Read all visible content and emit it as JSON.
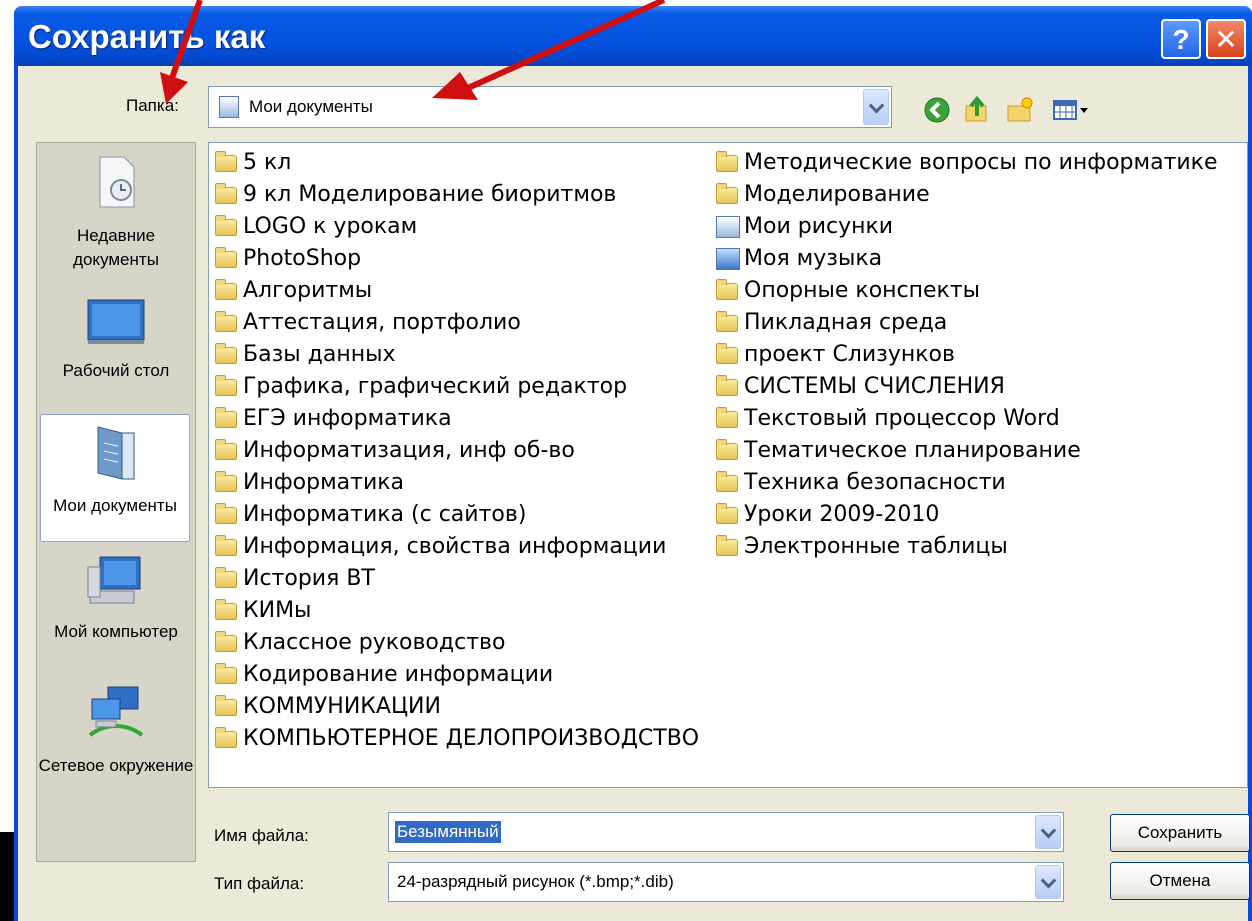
{
  "window": {
    "title": "Сохранить как",
    "help_label": "?",
    "close_label": "✕"
  },
  "lookin": {
    "label": "Папка:",
    "value": "Мои документы"
  },
  "toolbar": {
    "back_icon": "back-icon",
    "up_icon": "up-folder-icon",
    "newfolder_icon": "new-folder-icon",
    "views_icon": "views-menu-icon"
  },
  "places": [
    {
      "label": "Недавние документы",
      "icon": "recent-documents-icon"
    },
    {
      "label": "Рабочий стол",
      "icon": "desktop-icon"
    },
    {
      "label": "Мои документы",
      "icon": "my-documents-icon",
      "selected": true
    },
    {
      "label": "Мой компьютер",
      "icon": "my-computer-icon"
    },
    {
      "label": "Сетевое окружение",
      "icon": "network-icon"
    }
  ],
  "files_col1": [
    "5 кл",
    "9 кл Моделирование биоритмов",
    "LOGO к урокам",
    "PhotoShop",
    "Алгоритмы",
    "Аттестация, портфолио",
    "Базы данных",
    "Графика, графический редактор",
    "ЕГЭ информатика",
    "Информатизация, инф об-во",
    "Информатика",
    "Информатика (с сайтов)",
    "Информация, свойства информации",
    "История ВТ",
    "КИМы",
    "Классное руководство",
    "Кодирование информации",
    "КОММУНИКАЦИИ",
    "КОМПЬЮТЕРНОЕ ДЕЛОПРОИЗВОДСТВО"
  ],
  "files_col2": [
    "Методические вопросы по информатике",
    "Моделирование",
    "Мои рисунки",
    "Моя музыка",
    "Опорные конспекты",
    "Пикладная среда",
    "проект Слизунков",
    "СИСТЕМЫ СЧИСЛЕНИЯ",
    "Текстовый процессор Word",
    "Тематическое планирование",
    "Техника безопасности",
    "Уроки 2009-2010",
    "Электронные таблицы"
  ],
  "filename": {
    "label": "Имя файла:",
    "value": "Безымянный"
  },
  "filetype": {
    "label": "Тип файла:",
    "value": "24-разрядный рисунок (*.bmp;*.dib)"
  },
  "buttons": {
    "save": "Сохранить",
    "cancel": "Отмена"
  },
  "colors": {
    "accent": "#0a5be8",
    "annotation": "#d01010"
  }
}
